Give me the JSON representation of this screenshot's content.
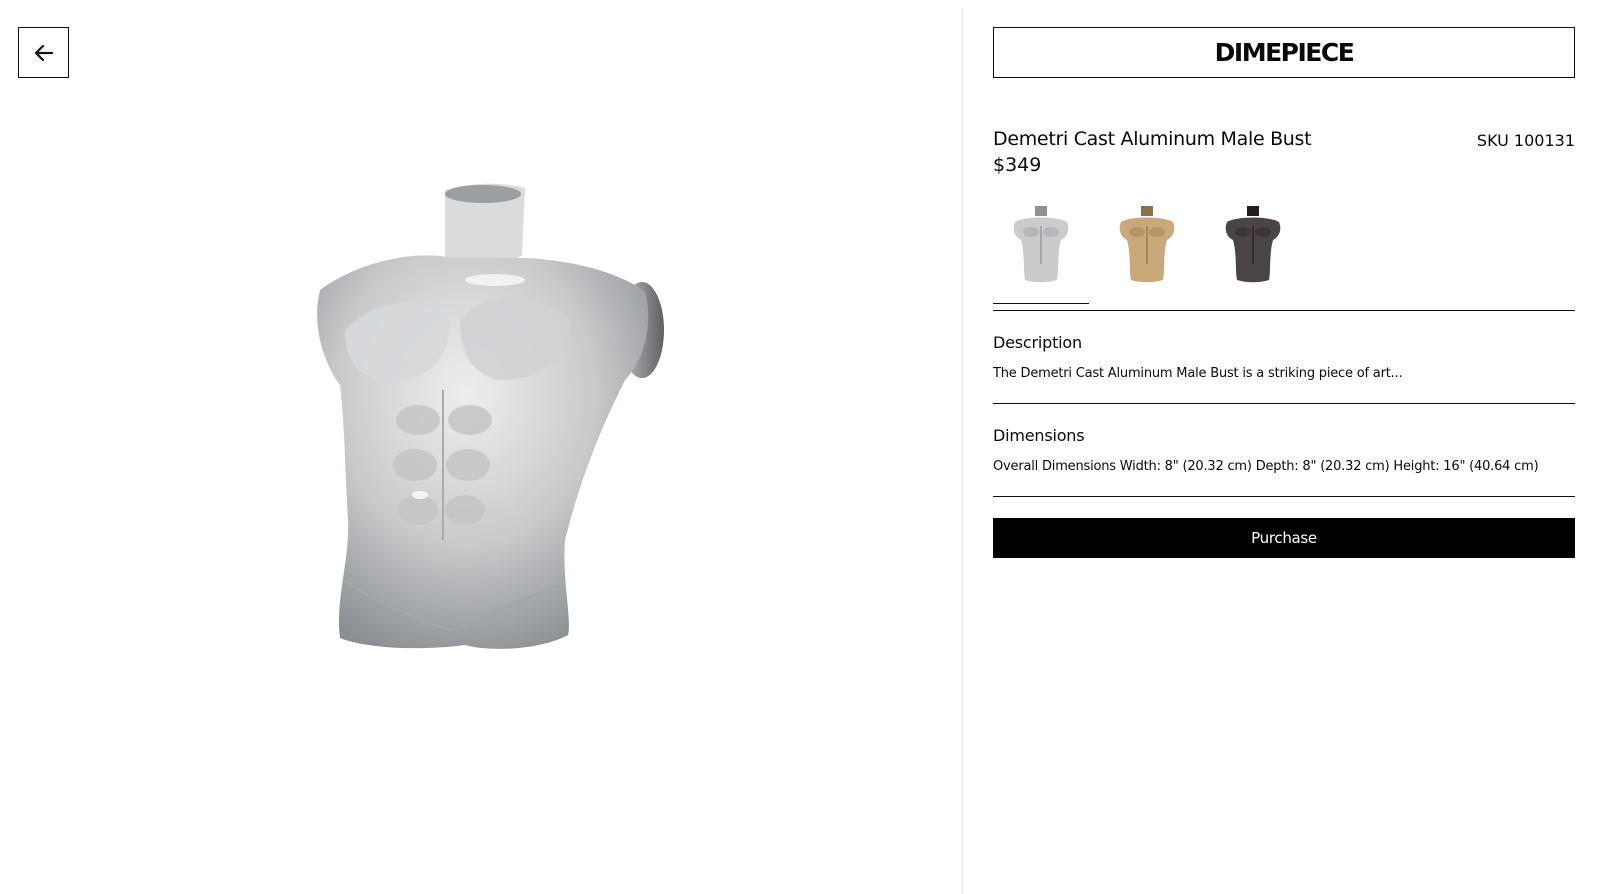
{
  "nav": {
    "back_icon": "arrow-left-icon"
  },
  "brand": {
    "name": "DIMEPIECE"
  },
  "product": {
    "title": "Demetri Cast Aluminum Male Bust",
    "sku": "SKU 100131",
    "price": "$349"
  },
  "variants": [
    {
      "name": "silver",
      "color": "#c9cbcd",
      "shade": "#8d9094",
      "selected": true
    },
    {
      "name": "gold",
      "color": "#c9a979",
      "shade": "#8e7146",
      "selected": false
    },
    {
      "name": "dark",
      "color": "#4a4445",
      "shade": "#221e1f",
      "selected": false
    }
  ],
  "description": {
    "heading": "Description",
    "text": "The Demetri Cast Aluminum Male Bust is a striking piece of art..."
  },
  "dimensions": {
    "heading": "Dimensions",
    "text": "Overall Dimensions Width: 8\" (20.32 cm) Depth: 8\" (20.32 cm) Height: 16\" (40.64 cm)"
  },
  "actions": {
    "purchase_label": "Purchase"
  },
  "colors": {
    "main_bust": "#d4d6d8",
    "accent": "#000000"
  }
}
